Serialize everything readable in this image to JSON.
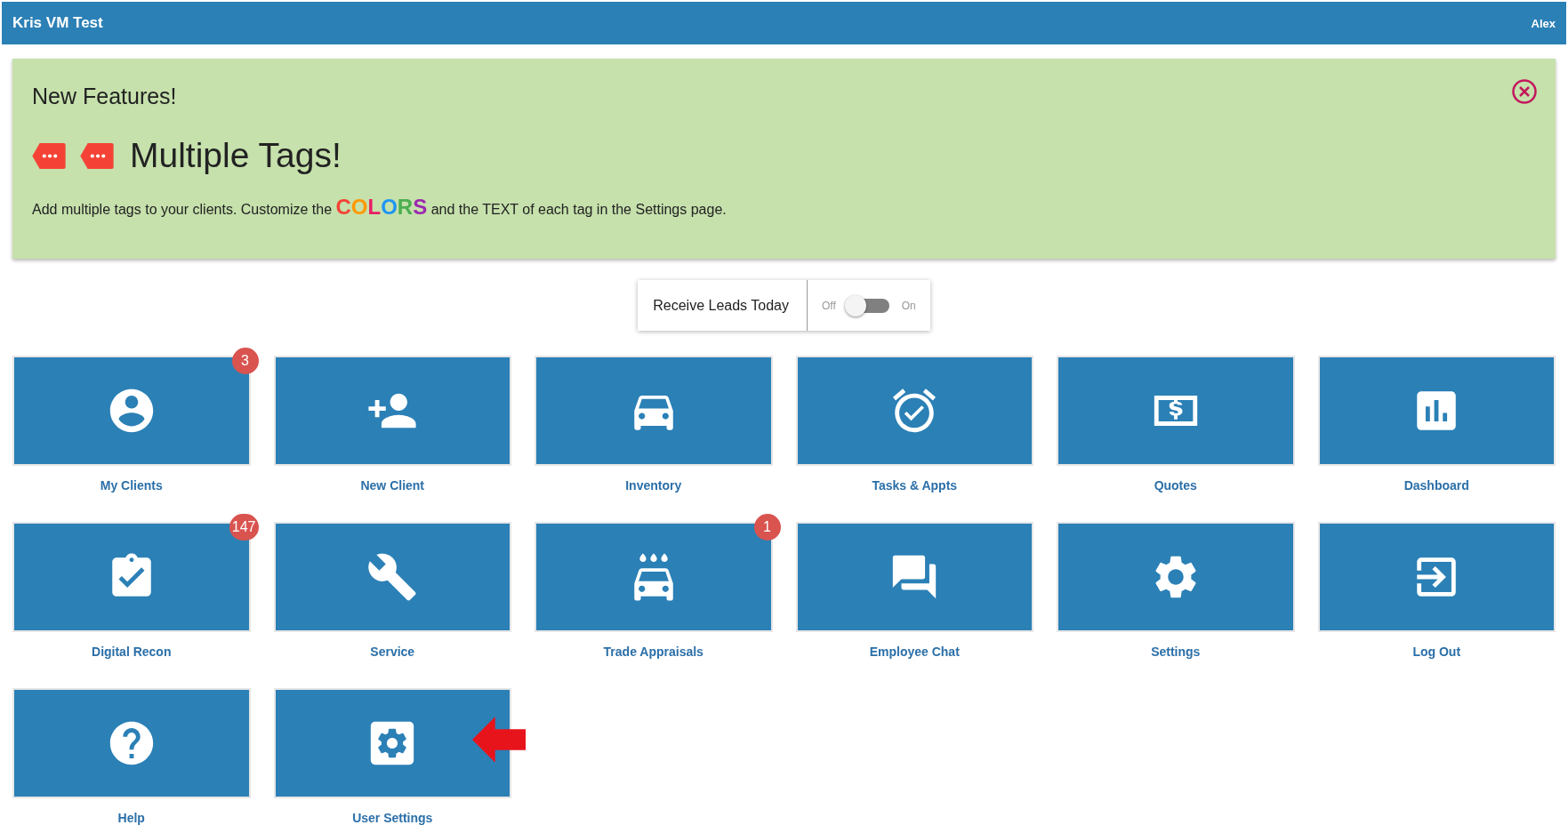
{
  "header": {
    "title": "Kris VM Test",
    "user": "Alex"
  },
  "banner": {
    "heading": "New Features!",
    "title": "Multiple Tags!",
    "text_before": "Add multiple tags to your clients. Customize the ",
    "colors_word": [
      {
        "letter": "C",
        "color": "#f44336"
      },
      {
        "letter": "O",
        "color": "#ff9800"
      },
      {
        "letter": "L",
        "color": "#e91e63"
      },
      {
        "letter": "O",
        "color": "#2196f3"
      },
      {
        "letter": "R",
        "color": "#4caf50"
      },
      {
        "letter": "S",
        "color": "#9c27b0"
      }
    ],
    "text_after": " and the TEXT of each tag in the Settings page."
  },
  "leads_toggle": {
    "label": "Receive Leads Today",
    "off_label": "Off",
    "on_label": "On",
    "on": false
  },
  "tiles": [
    {
      "label": "My Clients",
      "kind": "person-circle",
      "badge": "3"
    },
    {
      "label": "New Client",
      "kind": "person-add"
    },
    {
      "label": "Inventory",
      "kind": "car"
    },
    {
      "label": "Tasks & Appts",
      "kind": "alarm"
    },
    {
      "label": "Quotes",
      "kind": "dollar"
    },
    {
      "label": "Dashboard",
      "kind": "chart"
    },
    {
      "label": "Digital Recon",
      "kind": "clipboard",
      "badge": "147"
    },
    {
      "label": "Service",
      "kind": "wrench"
    },
    {
      "label": "Trade Appraisals",
      "kind": "carwash",
      "badge": "1"
    },
    {
      "label": "Employee Chat",
      "kind": "chat"
    },
    {
      "label": "Settings",
      "kind": "gear"
    },
    {
      "label": "Log Out",
      "kind": "logout"
    },
    {
      "label": "Help",
      "kind": "help"
    },
    {
      "label": "User Settings",
      "kind": "usergear",
      "pointer": true
    }
  ]
}
